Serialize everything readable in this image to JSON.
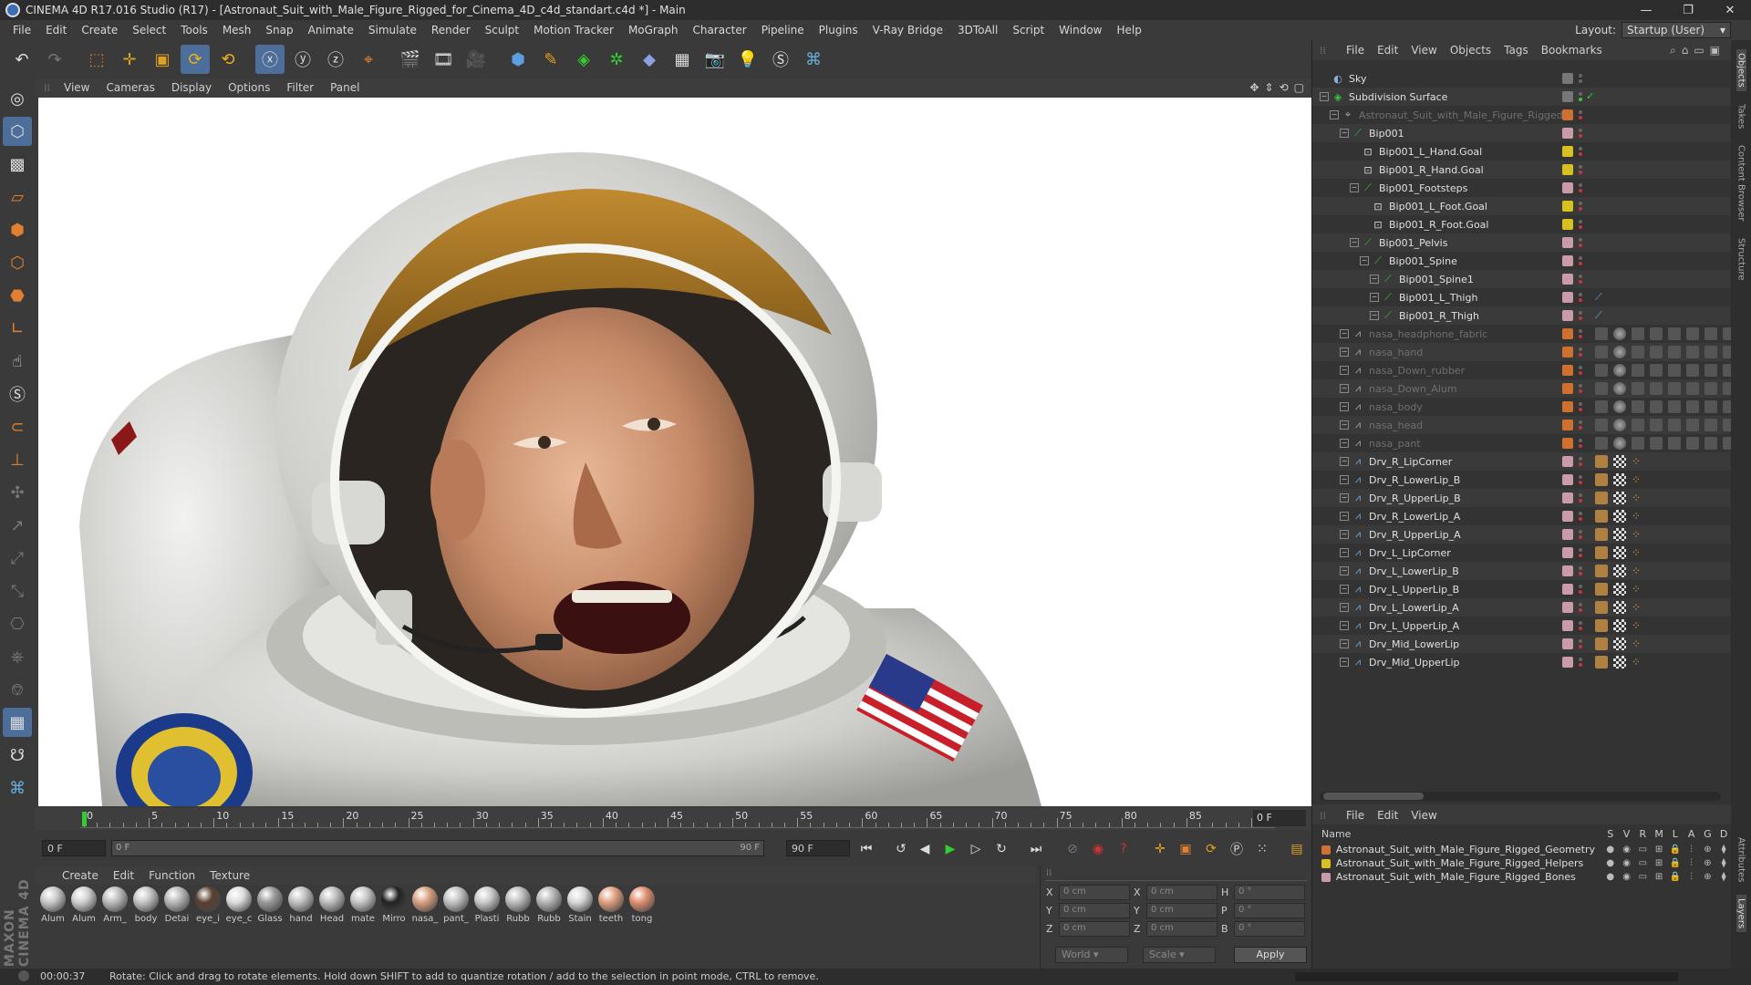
{
  "window": {
    "title": "CINEMA 4D R17.016 Studio (R17) - [Astronaut_Suit_with_Male_Figure_Rigged_for_Cinema_4D_c4d_standart.c4d *] - Main",
    "minimize": "—",
    "maximize": "❐",
    "close": "✕"
  },
  "menu": [
    "File",
    "Edit",
    "Create",
    "Select",
    "Tools",
    "Mesh",
    "Snap",
    "Animate",
    "Simulate",
    "Render",
    "Sculpt",
    "Motion Tracker",
    "MoGraph",
    "Character",
    "Pipeline",
    "Plugins",
    "V-Ray Bridge",
    "3DToAll",
    "Script",
    "Window",
    "Help"
  ],
  "layout": {
    "label": "Layout:",
    "value": "Startup (User)"
  },
  "viewport": {
    "menu": [
      "View",
      "Cameras",
      "Display",
      "Options",
      "Filter",
      "Panel"
    ]
  },
  "timeline": {
    "ticks": [
      "0",
      "5",
      "10",
      "15",
      "20",
      "25",
      "30",
      "35",
      "40",
      "45",
      "50",
      "55",
      "60",
      "65",
      "70",
      "75",
      "80",
      "85",
      "90"
    ],
    "current_frame": "0 F"
  },
  "transport": {
    "start_frame": "0 F",
    "slider_start": "0 F",
    "slider_end": "90 F",
    "end_frame": "90 F"
  },
  "material_manager": {
    "menu": [
      "Create",
      "Edit",
      "Function",
      "Texture"
    ],
    "materials": [
      {
        "label": "Alum",
        "color": "#c8c8c8"
      },
      {
        "label": "Alum",
        "color": "#d0d0d0"
      },
      {
        "label": "Arm_",
        "color": "#bcbcbc"
      },
      {
        "label": "body",
        "color": "#c4c4c4"
      },
      {
        "label": "Detai",
        "color": "#b8b8b8"
      },
      {
        "label": "eye_i",
        "color": "#5a4030"
      },
      {
        "label": "eye_c",
        "color": "#dddddd"
      },
      {
        "label": "Glass",
        "color": "#9a9a9a"
      },
      {
        "label": "hand",
        "color": "#c0c0c0"
      },
      {
        "label": "Head",
        "color": "#bdbdbd"
      },
      {
        "label": "mate",
        "color": "#c6c6c6"
      },
      {
        "label": "Mirro",
        "color": "#222222"
      },
      {
        "label": "nasa_",
        "color": "#d8a080"
      },
      {
        "label": "pant_",
        "color": "#c2c2c2"
      },
      {
        "label": "Plasti",
        "color": "#cacaca"
      },
      {
        "label": "Rubb",
        "color": "#bdbdbd"
      },
      {
        "label": "Rubb",
        "color": "#b5b5b5"
      },
      {
        "label": "Stain",
        "color": "#d8d8d8"
      },
      {
        "label": "teeth",
        "color": "#e0a080"
      },
      {
        "label": "tong",
        "color": "#e09070"
      }
    ]
  },
  "coordinates": {
    "rows": [
      {
        "a": "X",
        "av": "0 cm",
        "b": "X",
        "bv": "0 cm",
        "c": "H",
        "cv": "0 °"
      },
      {
        "a": "Y",
        "av": "0 cm",
        "b": "Y",
        "bv": "0 cm",
        "c": "P",
        "cv": "0 °"
      },
      {
        "a": "Z",
        "av": "0 cm",
        "b": "Z",
        "bv": "0 cm",
        "c": "B",
        "cv": "0 °"
      }
    ],
    "space": "World",
    "mode": "Scale",
    "apply": "Apply"
  },
  "object_manager": {
    "menu": [
      "File",
      "Edit",
      "View",
      "Objects",
      "Tags",
      "Bookmarks"
    ],
    "objects": [
      {
        "name": "Sky",
        "indent": 0,
        "icon": "sky",
        "dim": false,
        "expand": false,
        "layer": "",
        "status": "grey"
      },
      {
        "name": "Subdivision Surface",
        "indent": 0,
        "icon": "subdiv",
        "dim": false,
        "expand": true,
        "layer": "",
        "status": "green"
      },
      {
        "name": "Astronaut_Suit_with_Male_Figure_Rigged",
        "indent": 1,
        "icon": "null",
        "dim": true,
        "expand": true,
        "layer": "orange",
        "status": "red"
      },
      {
        "name": "Bip001",
        "indent": 2,
        "icon": "bone",
        "dim": false,
        "expand": true,
        "layer": "pink",
        "status": "red"
      },
      {
        "name": "Bip001_L_Hand.Goal",
        "indent": 3,
        "icon": "goal",
        "dim": false,
        "expand": false,
        "layer": "yellow",
        "status": "red"
      },
      {
        "name": "Bip001_R_Hand.Goal",
        "indent": 3,
        "icon": "goal",
        "dim": false,
        "expand": false,
        "layer": "yellow",
        "status": "red"
      },
      {
        "name": "Bip001_Footsteps",
        "indent": 3,
        "icon": "bone",
        "dim": false,
        "expand": true,
        "layer": "pink",
        "status": "red"
      },
      {
        "name": "Bip001_L_Foot.Goal",
        "indent": 4,
        "icon": "goal",
        "dim": false,
        "expand": false,
        "layer": "yellow",
        "status": "red"
      },
      {
        "name": "Bip001_R_Foot.Goal",
        "indent": 4,
        "icon": "goal",
        "dim": false,
        "expand": false,
        "layer": "yellow",
        "status": "red"
      },
      {
        "name": "Bip001_Pelvis",
        "indent": 3,
        "icon": "bone",
        "dim": false,
        "expand": true,
        "layer": "pink",
        "status": "red"
      },
      {
        "name": "Bip001_Spine",
        "indent": 4,
        "icon": "bone",
        "dim": false,
        "expand": true,
        "layer": "pink",
        "status": "red"
      },
      {
        "name": "Bip001_Spine1",
        "indent": 5,
        "icon": "bone",
        "dim": false,
        "expand": true,
        "layer": "pink",
        "status": "red"
      },
      {
        "name": "Bip001_L_Thigh",
        "indent": 5,
        "icon": "bone",
        "dim": false,
        "expand": true,
        "layer": "pink",
        "status": "red"
      },
      {
        "name": "Bip001_R_Thigh",
        "indent": 5,
        "icon": "bone",
        "dim": false,
        "expand": true,
        "layer": "pink",
        "status": "red"
      },
      {
        "name": "nasa_headphone_fabric",
        "indent": 2,
        "icon": "mesh",
        "dim": true,
        "expand": true,
        "layer": "orange",
        "status": "red"
      },
      {
        "name": "nasa_hand",
        "indent": 2,
        "icon": "mesh",
        "dim": true,
        "expand": true,
        "layer": "orange",
        "status": "red"
      },
      {
        "name": "nasa_Down_rubber",
        "indent": 2,
        "icon": "mesh",
        "dim": true,
        "expand": true,
        "layer": "orange",
        "status": "red"
      },
      {
        "name": "nasa_Down_Alum",
        "indent": 2,
        "icon": "mesh",
        "dim": true,
        "expand": true,
        "layer": "orange",
        "status": "red"
      },
      {
        "name": "nasa_body",
        "indent": 2,
        "icon": "mesh",
        "dim": true,
        "expand": true,
        "layer": "orange",
        "status": "red"
      },
      {
        "name": "nasa_head",
        "indent": 2,
        "icon": "mesh",
        "dim": true,
        "expand": true,
        "layer": "orange",
        "status": "red"
      },
      {
        "name": "nasa_pant",
        "indent": 2,
        "icon": "mesh",
        "dim": true,
        "expand": true,
        "layer": "orange",
        "status": "red"
      },
      {
        "name": "Drv_R_LipCorner",
        "indent": 2,
        "icon": "joint",
        "dim": false,
        "expand": true,
        "layer": "pink",
        "status": "red"
      },
      {
        "name": "Drv_R_LowerLip_B",
        "indent": 2,
        "icon": "joint",
        "dim": false,
        "expand": true,
        "layer": "pink",
        "status": "red"
      },
      {
        "name": "Drv_R_UpperLip_B",
        "indent": 2,
        "icon": "joint",
        "dim": false,
        "expand": true,
        "layer": "pink",
        "status": "red"
      },
      {
        "name": "Drv_R_LowerLip_A",
        "indent": 2,
        "icon": "joint",
        "dim": false,
        "expand": true,
        "layer": "pink",
        "status": "red"
      },
      {
        "name": "Drv_R_UpperLip_A",
        "indent": 2,
        "icon": "joint",
        "dim": false,
        "expand": true,
        "layer": "pink",
        "status": "red"
      },
      {
        "name": "Drv_L_LipCorner",
        "indent": 2,
        "icon": "joint",
        "dim": false,
        "expand": true,
        "layer": "pink",
        "status": "red"
      },
      {
        "name": "Drv_L_LowerLip_B",
        "indent": 2,
        "icon": "joint",
        "dim": false,
        "expand": true,
        "layer": "pink",
        "status": "red"
      },
      {
        "name": "Drv_L_UpperLip_B",
        "indent": 2,
        "icon": "joint",
        "dim": false,
        "expand": true,
        "layer": "pink",
        "status": "red"
      },
      {
        "name": "Drv_L_LowerLip_A",
        "indent": 2,
        "icon": "joint",
        "dim": false,
        "expand": true,
        "layer": "pink",
        "status": "red"
      },
      {
        "name": "Drv_L_UpperLip_A",
        "indent": 2,
        "icon": "joint",
        "dim": false,
        "expand": true,
        "layer": "pink",
        "status": "red"
      },
      {
        "name": "Drv_Mid_LowerLip",
        "indent": 2,
        "icon": "joint",
        "dim": false,
        "expand": true,
        "layer": "pink",
        "status": "red"
      },
      {
        "name": "Drv_Mid_UpperLip",
        "indent": 2,
        "icon": "joint",
        "dim": false,
        "expand": true,
        "layer": "pink",
        "status": "red"
      }
    ]
  },
  "layer_manager": {
    "menu": [
      "File",
      "Edit",
      "View"
    ],
    "header": {
      "name": "Name",
      "cols": [
        "S",
        "V",
        "R",
        "M",
        "L",
        "A",
        "G",
        "D"
      ]
    },
    "layers": [
      {
        "name": "Astronaut_Suit_with_Male_Figure_Rigged_Geometry",
        "color": "#d07030"
      },
      {
        "name": "Astronaut_Suit_with_Male_Figure_Rigged_Helpers",
        "color": "#d8c020"
      },
      {
        "name": "Astronaut_Suit_with_Male_Figure_Rigged_Bones",
        "color": "#c99aaa"
      }
    ]
  },
  "side_tabs": [
    "Objects",
    "Takes",
    "Content Browser",
    "Structure"
  ],
  "side_tabs_bottom": [
    "Attributes",
    "Layers"
  ],
  "status": {
    "time": "00:00:37",
    "message": "Rotate: Click and drag to rotate elements. Hold down SHIFT to add to quantize rotation / add to the selection in point mode, CTRL to remove."
  },
  "maxon": "MAXON CINEMA 4D",
  "colors": {
    "accent": "#4d6e99",
    "play": "#3c3",
    "record": "#c33"
  }
}
